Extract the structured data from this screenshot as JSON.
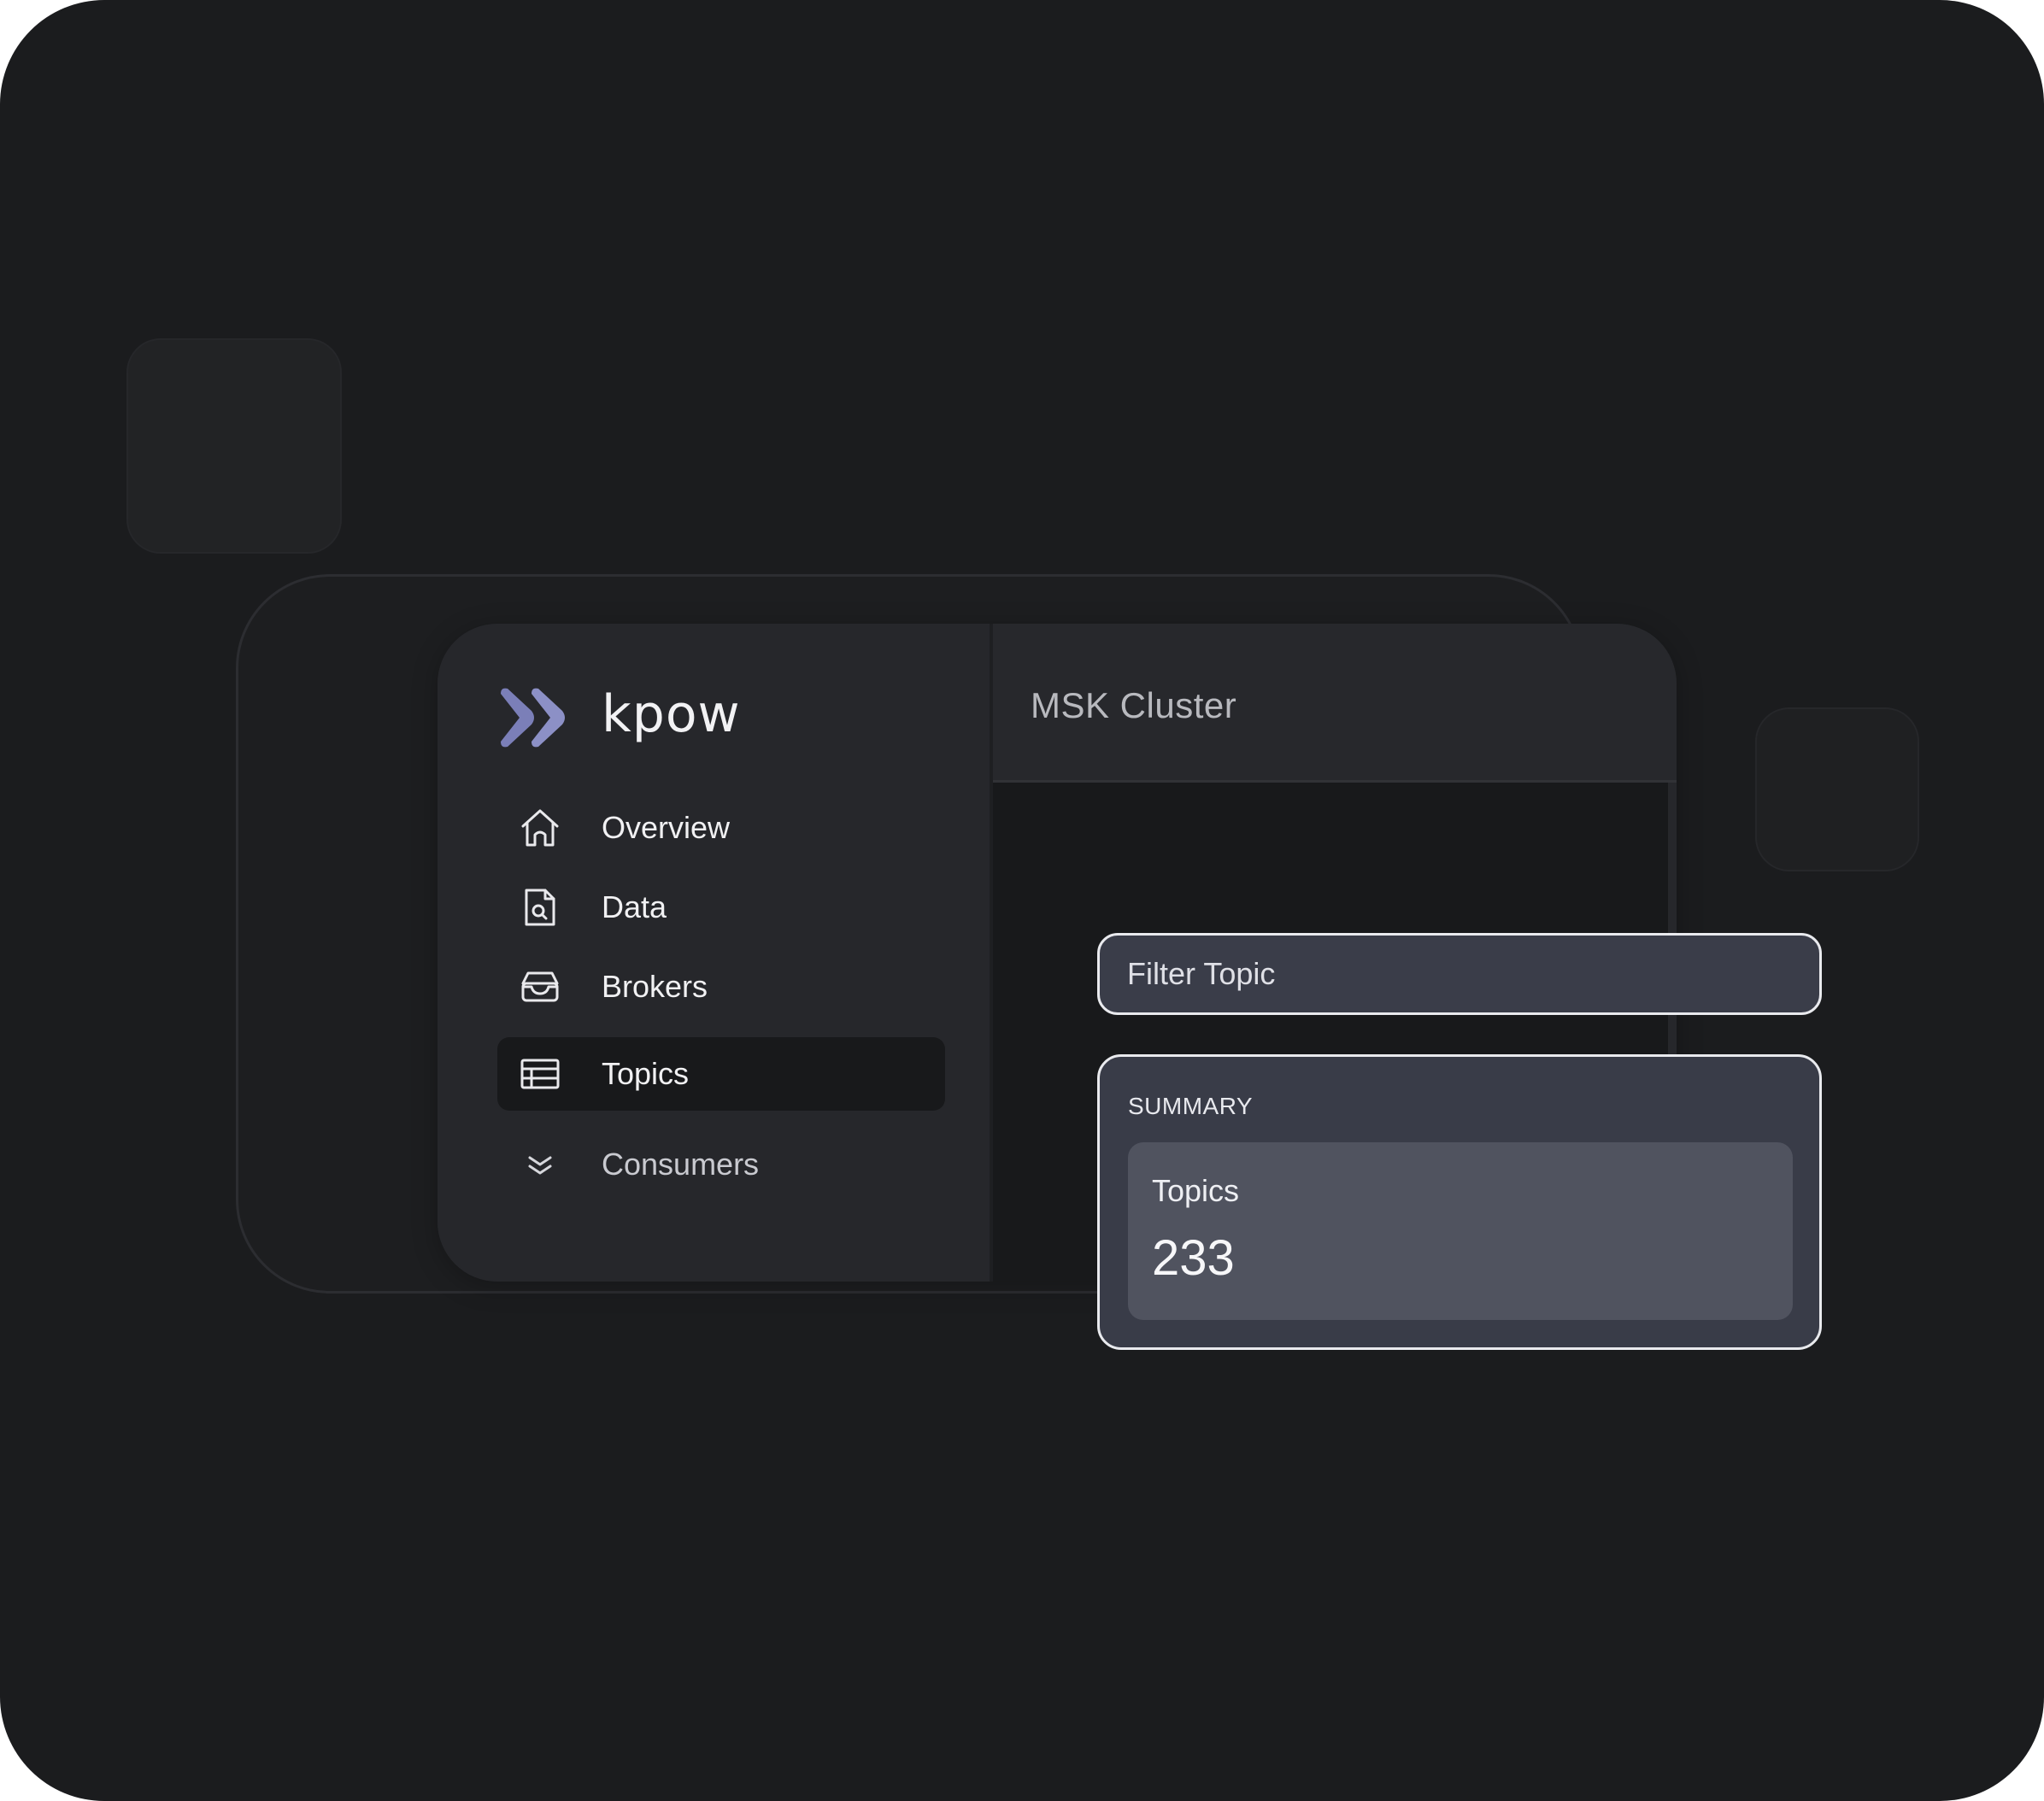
{
  "app": {
    "brand_name": "kpow",
    "logo_color": "#7b7fb8"
  },
  "sidebar": {
    "items": [
      {
        "label": "Overview",
        "icon": "home-icon",
        "active": false
      },
      {
        "label": "Data",
        "icon": "document-search-icon",
        "active": false
      },
      {
        "label": "Brokers",
        "icon": "inbox-tray-icon",
        "active": false
      },
      {
        "label": "Topics",
        "icon": "table-icon",
        "active": true
      },
      {
        "label": "Consumers",
        "icon": "chevrons-down-icon",
        "active": false
      }
    ]
  },
  "main": {
    "title": "MSK Cluster"
  },
  "filter": {
    "placeholder": "Filter Topic"
  },
  "summary": {
    "title": "SUMMARY",
    "tiles": [
      {
        "label": "Topics",
        "value": "233"
      }
    ]
  },
  "colors": {
    "background": "#1b1c1e",
    "panel": "#26272b",
    "active_item": "#18191b",
    "card": "#393c48",
    "tile": "#50535f",
    "card_border": "#e9eaee"
  }
}
